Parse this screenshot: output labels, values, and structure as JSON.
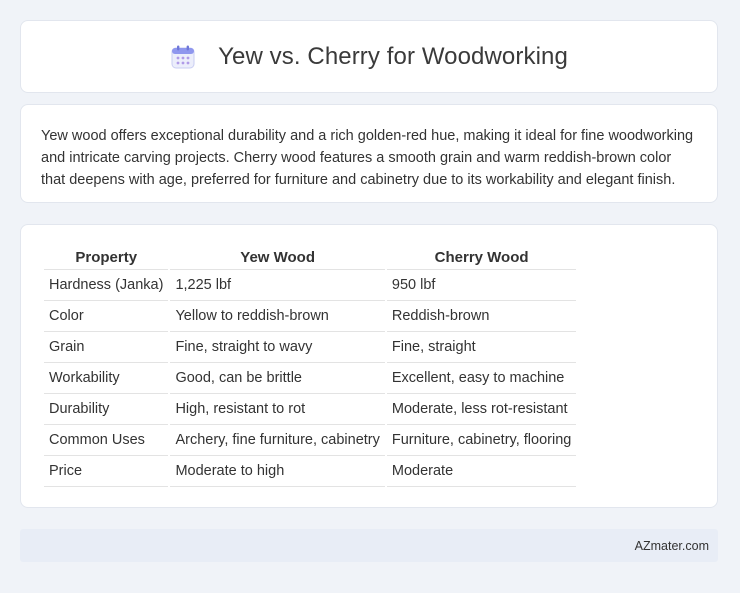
{
  "header": {
    "icon": "calendar-icon",
    "title": "Yew vs. Cherry for Woodworking"
  },
  "intro": {
    "text": "Yew wood offers exceptional durability and a rich golden-red hue, making it ideal for fine woodworking and intricate carving projects. Cherry wood features a smooth grain and warm reddish-brown color that deepens with age, preferred for furniture and cabinetry due to its workability and elegant finish."
  },
  "table": {
    "headers": [
      "Property",
      "Yew Wood",
      "Cherry Wood"
    ],
    "rows": [
      [
        "Hardness (Janka)",
        "1,225 lbf",
        "950 lbf"
      ],
      [
        "Color",
        "Yellow to reddish-brown",
        "Reddish-brown"
      ],
      [
        "Grain",
        "Fine, straight to wavy",
        "Fine, straight"
      ],
      [
        "Workability",
        "Good, can be brittle",
        "Excellent, easy to machine"
      ],
      [
        "Durability",
        "High, resistant to rot",
        "Moderate, less rot-resistant"
      ],
      [
        "Common Uses",
        "Archery, fine furniture, cabinetry",
        "Furniture, cabinetry, flooring"
      ],
      [
        "Price",
        "Moderate to high",
        "Moderate"
      ]
    ]
  },
  "footer": {
    "text": "AZmater.com"
  },
  "colors": {
    "background": "#f0f3f8",
    "card": "#ffffff",
    "footer_bg": "#e8edf6",
    "icon_accent": "#7b8ff0"
  }
}
